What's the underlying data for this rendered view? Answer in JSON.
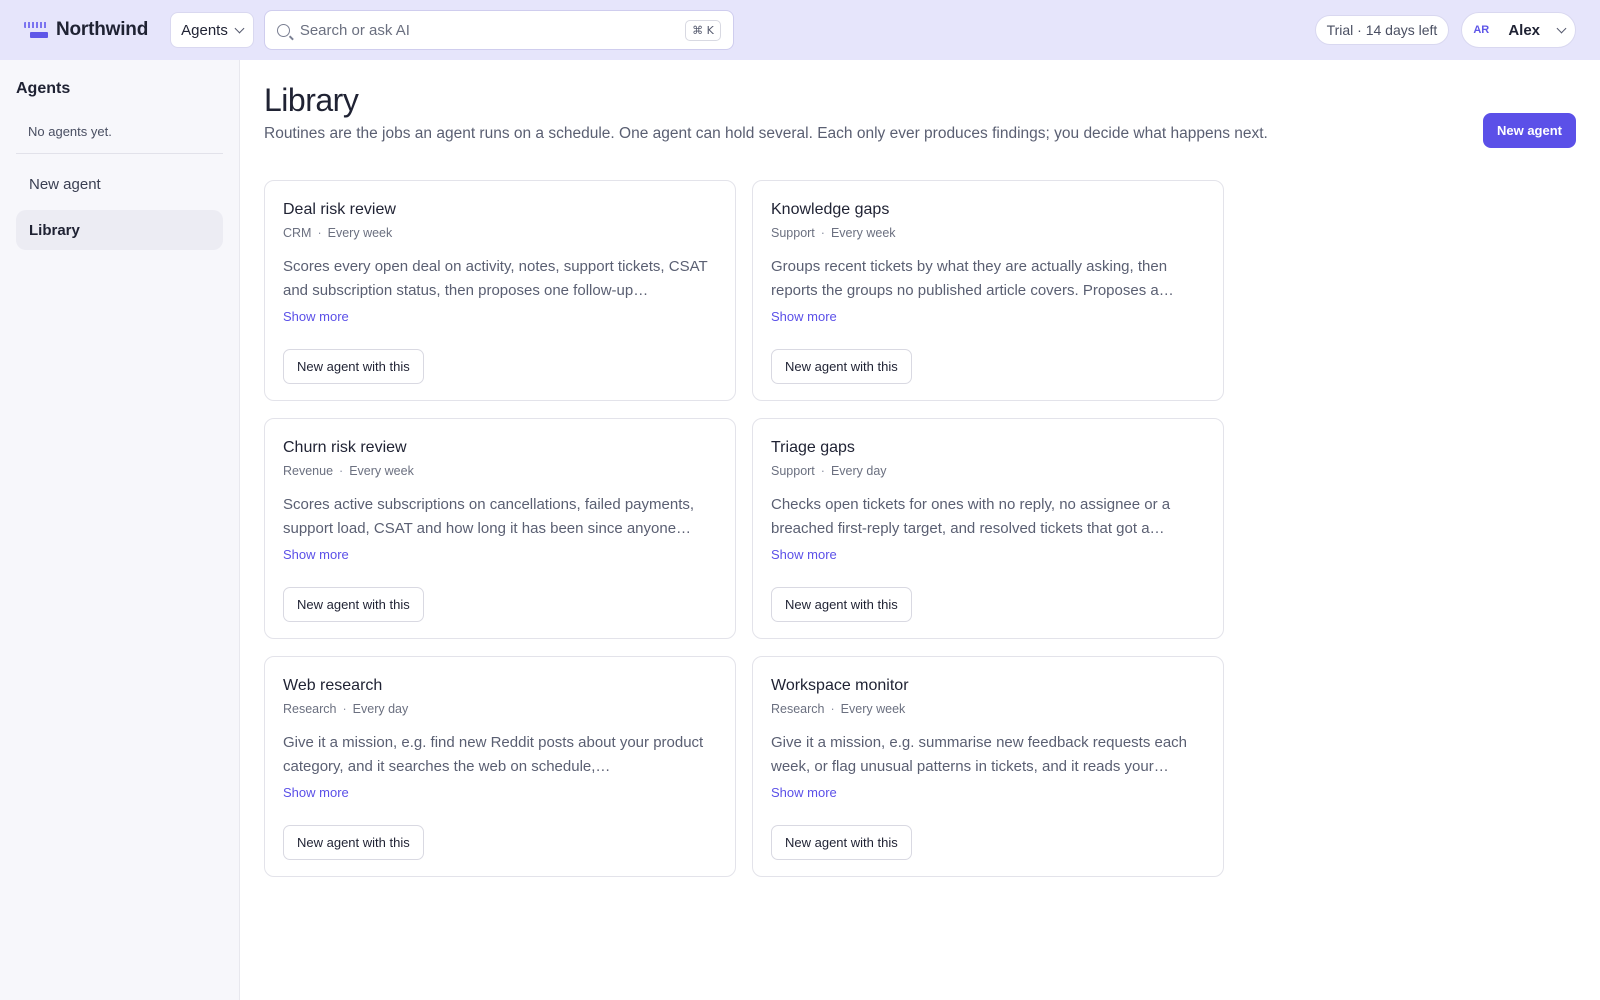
{
  "header": {
    "brand": "Northwind",
    "switcher_label": "Agents",
    "search_placeholder": "Search or ask AI",
    "search_shortcut": "⌘ K",
    "trial_label": "Trial · 14 days left",
    "user_initials": "AR",
    "user_name": "Alex"
  },
  "sidebar": {
    "title": "Agents",
    "empty_text": "No agents yet.",
    "items": [
      {
        "label": "New agent",
        "active": false
      },
      {
        "label": "Library",
        "active": true
      }
    ]
  },
  "main": {
    "title": "Library",
    "subtitle": "Routines are the jobs an agent runs on a schedule. One agent can hold several. Each only ever produces findings; you decide what happens next.",
    "new_agent_label": "New agent",
    "show_more_label": "Show more",
    "card_button_label": "New agent with this",
    "cards": [
      {
        "title": "Deal risk review",
        "category": "CRM",
        "schedule": "Every week",
        "description": "Scores every open deal on activity, notes, support tickets, CSAT and subscription status, then proposes one follow-up…"
      },
      {
        "title": "Knowledge gaps",
        "category": "Support",
        "schedule": "Every week",
        "description": "Groups recent tickets by what they are actually asking, then reports the groups no published article covers. Proposes a…"
      },
      {
        "title": "Churn risk review",
        "category": "Revenue",
        "schedule": "Every week",
        "description": "Scores active subscriptions on cancellations, failed payments, support load, CSAT and how long it has been since anyone…"
      },
      {
        "title": "Triage gaps",
        "category": "Support",
        "schedule": "Every day",
        "description": "Checks open tickets for ones with no reply, no assignee or a breached first-reply target, and resolved tickets that got a…"
      },
      {
        "title": "Web research",
        "category": "Research",
        "schedule": "Every day",
        "description": "Give it a mission, e.g. find new Reddit posts about your product category, and it searches the web on schedule,…"
      },
      {
        "title": "Workspace monitor",
        "category": "Research",
        "schedule": "Every week",
        "description": "Give it a mission, e.g. summarise new feedback requests each week, or flag unusual patterns in tickets, and it reads your…"
      }
    ]
  },
  "colors": {
    "accent": "#5b50e8",
    "topbar_bg": "#e6e5fb",
    "sidebar_bg": "#f7f7fb"
  }
}
